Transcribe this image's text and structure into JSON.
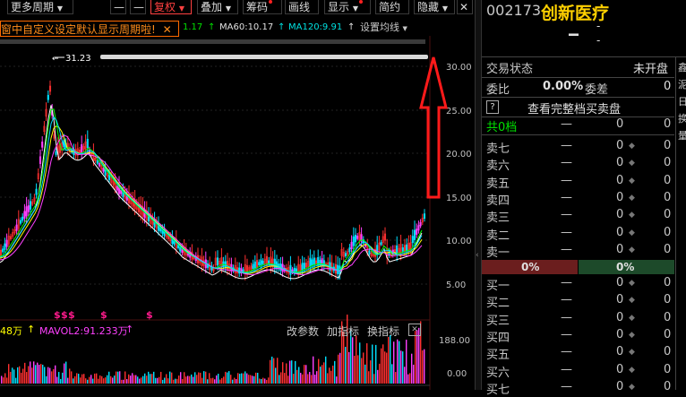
{
  "toolbar": {
    "more_period": "更多周期",
    "fuquan": "复权",
    "overlay": "叠加",
    "chips": "筹码",
    "draw_line": "画线",
    "display": "显示",
    "simple": "简约",
    "hide": "隐藏",
    "minimize_glyph": "—",
    "close_glyph": "✕"
  },
  "notice": {
    "text": "窗中自定义设定默认显示周期啦!",
    "close": "✕"
  },
  "ma_line": {
    "ma_partial": "1.17",
    "ma60": "MA60:10.17",
    "ma120": "MA120:9.91",
    "settings": "设置均线"
  },
  "colors": {
    "ma_partial": "#00e000",
    "ma60": "#00e0e0",
    "ma120": "#e0e0e0",
    "up": "#ff3030",
    "down": "#00e0ff",
    "accent_orange": "#ff8c1a",
    "price_text": "#ffd000",
    "bid_bar": "#6b1e1e",
    "ask_bar": "#1d4a2a"
  },
  "main_chart": {
    "max_label": "31.23",
    "y_ticks": [
      "30.00",
      "25.00",
      "20.00",
      "15.00",
      "10.00",
      "5.00"
    ],
    "event_marks": [
      "$",
      "$",
      "$",
      "$",
      "$"
    ]
  },
  "volume_panel": {
    "mavol1_partial": "48万",
    "mavol2": "MAVOL2:91.233万",
    "tab_params": "改参数",
    "tab_add_indicator": "加指标",
    "tab_switch_indicator": "换指标",
    "y_ticks": [
      "188.00",
      "0.00"
    ]
  },
  "stock": {
    "code": "002173",
    "name": "创新医疗",
    "price": "--",
    "change1": "-",
    "change2": "-"
  },
  "panel": {
    "status_label": "交易状态",
    "status_value": "未开盘",
    "weibi_label": "委比",
    "weibi_value": "0.00%",
    "weicha_label": "委差",
    "weicha_value": "0",
    "help": "?",
    "full_book": "查看完整档买卖盘",
    "levels_label": "共0档",
    "levels_dash": "—",
    "levels_v1": "0",
    "levels_v2": "0",
    "sells": [
      {
        "label": "卖七",
        "price": "—",
        "vol": "0",
        "add": "0"
      },
      {
        "label": "卖六",
        "price": "—",
        "vol": "0",
        "add": "0"
      },
      {
        "label": "卖五",
        "price": "—",
        "vol": "0",
        "add": "0"
      },
      {
        "label": "卖四",
        "price": "—",
        "vol": "0",
        "add": "0"
      },
      {
        "label": "卖三",
        "price": "—",
        "vol": "0",
        "add": "0"
      },
      {
        "label": "卖二",
        "price": "—",
        "vol": "0",
        "add": "0"
      },
      {
        "label": "卖一",
        "price": "—",
        "vol": "0",
        "add": "0"
      }
    ],
    "bid_pct": "0%",
    "ask_pct": "0%",
    "buys": [
      {
        "label": "买一",
        "price": "—",
        "vol": "0",
        "add": "0"
      },
      {
        "label": "买二",
        "price": "—",
        "vol": "0",
        "add": "0"
      },
      {
        "label": "买三",
        "price": "—",
        "vol": "0",
        "add": "0"
      },
      {
        "label": "买四",
        "price": "—",
        "vol": "0",
        "add": "0"
      },
      {
        "label": "买五",
        "price": "—",
        "vol": "0",
        "add": "0"
      },
      {
        "label": "买六",
        "price": "—",
        "vol": "0",
        "add": "0"
      },
      {
        "label": "买七",
        "price": "—",
        "vol": "0",
        "add": "0"
      }
    ],
    "side_tabs": [
      "鑫",
      "泥",
      "日",
      "换",
      "量"
    ]
  }
}
